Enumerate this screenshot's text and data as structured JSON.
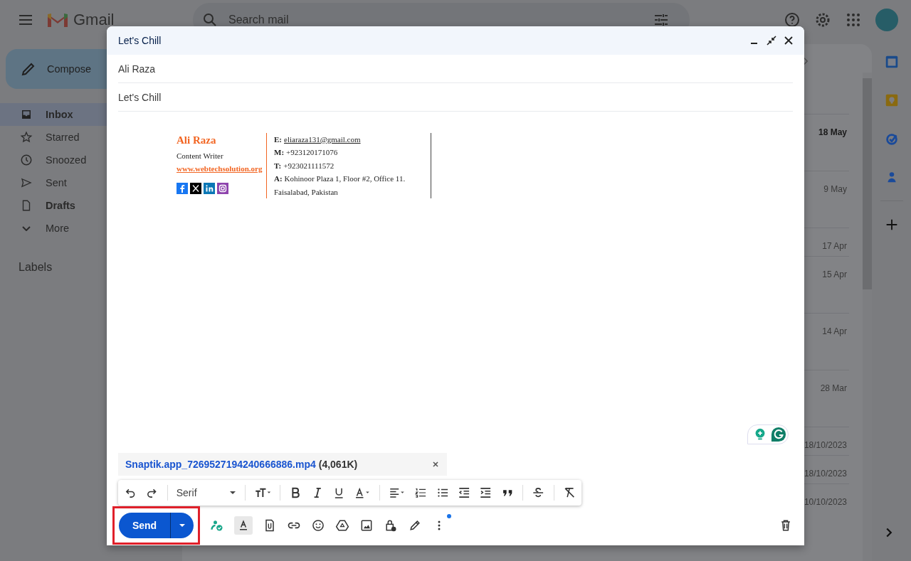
{
  "header": {
    "brand": "Gmail",
    "search": {
      "placeholder": "Search mail"
    }
  },
  "compose_button": "Compose",
  "sidebar": {
    "items": [
      {
        "label": "Inbox",
        "selected": true,
        "bold": true
      },
      {
        "label": "Starred",
        "selected": false,
        "bold": false
      },
      {
        "label": "Snoozed",
        "selected": false,
        "bold": false
      },
      {
        "label": "Sent",
        "selected": false,
        "bold": false
      },
      {
        "label": "Drafts",
        "selected": false,
        "bold": true
      },
      {
        "label": "More",
        "selected": false,
        "bold": false
      }
    ],
    "labels_heading": "Labels"
  },
  "mail_list": {
    "rows": [
      {
        "date": "18 May",
        "unread": true,
        "tall": true
      },
      {
        "date": "9 May",
        "unread": false,
        "tall": true
      },
      {
        "date": "17 Apr",
        "unread": false,
        "tall": false
      },
      {
        "date": "15 Apr",
        "unread": false,
        "tall": true
      },
      {
        "date": "14 Apr",
        "unread": false,
        "tall": true
      },
      {
        "date": "28 Mar",
        "unread": false,
        "tall": true
      },
      {
        "date": "18/10/2023",
        "unread": false,
        "tall": false
      },
      {
        "date": "18/10/2023",
        "unread": false,
        "tall": false
      },
      {
        "date": "10/10/2023",
        "unread": false,
        "tall": true
      }
    ]
  },
  "compose": {
    "title": "Let's Chill",
    "to": "Ali Raza",
    "subject": "Let's Chill",
    "signature": {
      "name": "Ali Raza",
      "role": "Content Writer",
      "website": "www.webtechsolution.org",
      "lines": [
        {
          "label": "E:",
          "value": "eliaraza131@gmail.com",
          "link": true
        },
        {
          "label": "M:",
          "value": "+923120171076",
          "link": false
        },
        {
          "label": "T:",
          "value": "+923021111572",
          "link": false
        },
        {
          "label": "A:",
          "value": "Kohinoor Plaza 1, Floor #2, Office 11.",
          "link": false
        },
        {
          "value": "Faisalabad, Pakistan",
          "link": false
        }
      ]
    },
    "attachment": {
      "name": "Snaptik.app_7269527194240666886.mp4",
      "size": "(4,061K)"
    },
    "font": "Serif",
    "send": {
      "label": "Send",
      "highlighted": true
    },
    "more_options_notification": true
  }
}
